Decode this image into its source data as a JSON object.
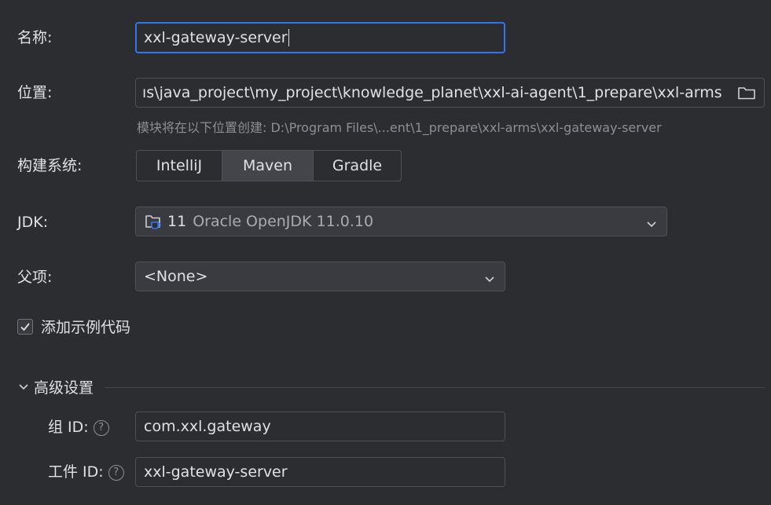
{
  "name": {
    "label": "名称:",
    "value": "xxl-gateway-server"
  },
  "location": {
    "label": "位置:",
    "value": "ıs\\java_project\\my_project\\knowledge_planet\\xxl-ai-agent\\1_prepare\\xxl-arms",
    "hint": "模块将在以下位置创建: D:\\Program Files\\...ent\\1_prepare\\xxl-arms\\xxl-gateway-server"
  },
  "build_system": {
    "label": "构建系统:",
    "options": [
      "IntelliJ",
      "Maven",
      "Gradle"
    ],
    "selected": "Maven"
  },
  "jdk": {
    "label": "JDK:",
    "version": "11",
    "name": "Oracle OpenJDK 11.0.10"
  },
  "parent": {
    "label": "父项:",
    "value": "<None>"
  },
  "sample_code": {
    "label": "添加示例代码",
    "checked": true
  },
  "advanced": {
    "label": "高级设置",
    "group_id_label": "组 ID:",
    "group_id_value": "com.xxl.gateway",
    "artifact_id_label": "工件 ID:",
    "artifact_id_value": "xxl-gateway-server",
    "help_glyph": "?"
  },
  "colors": {
    "background": "#2b2d30",
    "accent": "#3574f0",
    "border": "#4e5157",
    "hint": "#8c8f94"
  }
}
